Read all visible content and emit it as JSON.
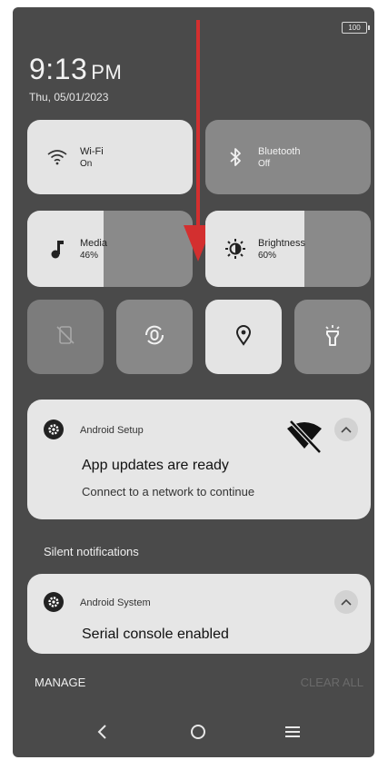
{
  "status": {
    "battery": "100"
  },
  "header": {
    "time": "9:13",
    "ampm": "PM",
    "date": "Thu, 05/01/2023"
  },
  "tiles": {
    "wifi": {
      "label": "Wi-Fi",
      "state": "On"
    },
    "bluetooth": {
      "label": "Bluetooth",
      "state": "Off"
    },
    "media": {
      "label": "Media",
      "value": "46%",
      "level": 0.46
    },
    "brightness": {
      "label": "Brightness",
      "value": "60%",
      "level": 0.6
    }
  },
  "quick_toggles": [
    "auto-rotate-off-icon",
    "screen-record-icon",
    "location-icon",
    "flashlight-icon"
  ],
  "notifications": [
    {
      "app": "Android Setup",
      "title": "App updates are ready",
      "body": "Connect to a network to continue"
    }
  ],
  "silent_section": {
    "label": "Silent notifications",
    "items": [
      {
        "app": "Android System",
        "title": "Serial console enabled"
      }
    ]
  },
  "footer": {
    "manage": "MANAGE",
    "clear_all": "CLEAR ALL"
  },
  "colors": {
    "arrow": "#d32f2f",
    "panel": "#4a4a4a",
    "tile_on": "#e4e4e4"
  }
}
